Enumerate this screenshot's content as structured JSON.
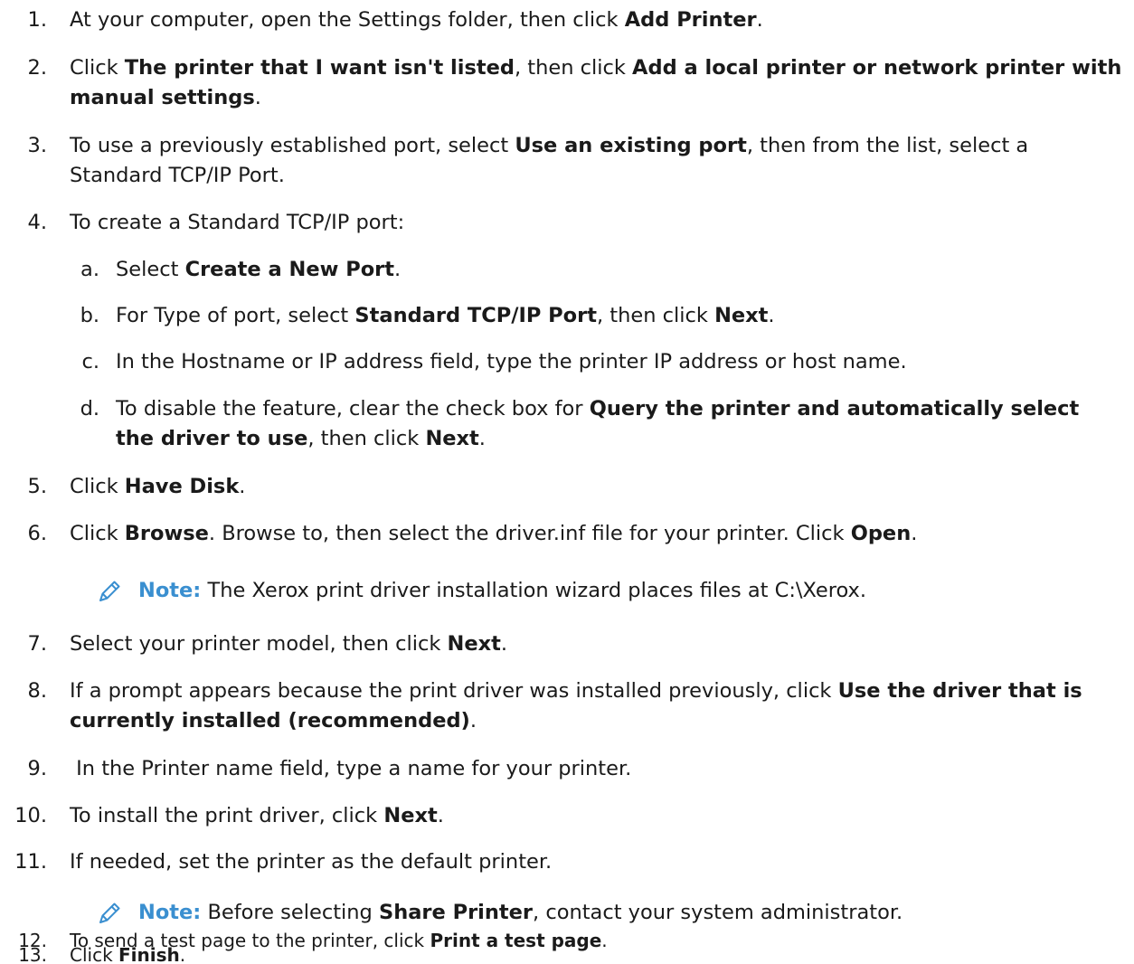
{
  "steps": [
    {
      "num": "1.",
      "parts": [
        "At your computer, open the Settings folder, then click ",
        "Add Printer",
        "."
      ]
    },
    {
      "num": "2.",
      "line1": [
        "Click ",
        "The printer that I want isn't listed",
        ", then click ",
        "Add a local printer or network printer with"
      ],
      "line2": [
        "manual settings",
        "."
      ]
    },
    {
      "num": "3.",
      "line1": [
        "To use a previously established port, select ",
        "Use an existing port",
        ", then from the list, select a"
      ],
      "line2": "Standard TCP/IP Port."
    },
    {
      "num": "4.",
      "text": "To create a Standard TCP/IP port:"
    },
    {
      "num": "5.",
      "parts": [
        "Click ",
        "Have Disk",
        "."
      ]
    },
    {
      "num": "6.",
      "parts": [
        "Click ",
        "Browse",
        ". Browse to, then select the driver.inf file for your printer. Click ",
        "Open",
        "."
      ]
    },
    {
      "num": "7.",
      "parts": [
        "Select your printer model, then click ",
        "Next",
        "."
      ]
    },
    {
      "num": "8.",
      "line1": [
        "If a prompt appears because the print driver was installed previously, click ",
        "Use the driver that is"
      ],
      "line2": [
        "currently installed (recommended)",
        "."
      ]
    },
    {
      "num": "9.",
      "text": " In the Printer name field, type a name for your printer."
    },
    {
      "num": "10.",
      "parts": [
        "To install the print driver, click ",
        "Next",
        "."
      ]
    },
    {
      "num": "11.",
      "text": "If needed, set the printer as the default printer."
    },
    {
      "num": "12.",
      "parts": [
        "To send a test page to the printer, click ",
        "Print a test page",
        "."
      ]
    },
    {
      "num": "13.",
      "parts": [
        "Click ",
        "Finish",
        "."
      ]
    }
  ],
  "substeps": [
    {
      "num": "a.",
      "parts": [
        "Select ",
        "Create a New Port",
        "."
      ]
    },
    {
      "num": "b.",
      "parts": [
        "For Type of port, select ",
        "Standard TCP/IP Port",
        ", then click ",
        "Next",
        "."
      ]
    },
    {
      "num": "c.",
      "text": "In the Hostname or IP address field, type the printer IP address or host name."
    },
    {
      "num": "d.",
      "line1": [
        "To disable the feature, clear the check box for ",
        "Query the printer and automatically select"
      ],
      "line2": [
        "the driver to use",
        ", then click ",
        "Next",
        "."
      ]
    }
  ],
  "notes": [
    {
      "label": "Note:",
      "parts": [
        " The Xerox print driver installation wizard places files at C:\\Xerox."
      ]
    },
    {
      "label": "Note:",
      "parts": [
        " Before selecting ",
        "Share Printer",
        ", contact your system administrator."
      ]
    }
  ],
  "colors": {
    "note_label": "#3a8fd0",
    "text": "#1a1a1a"
  },
  "icons": {
    "note": "pencil-icon"
  }
}
